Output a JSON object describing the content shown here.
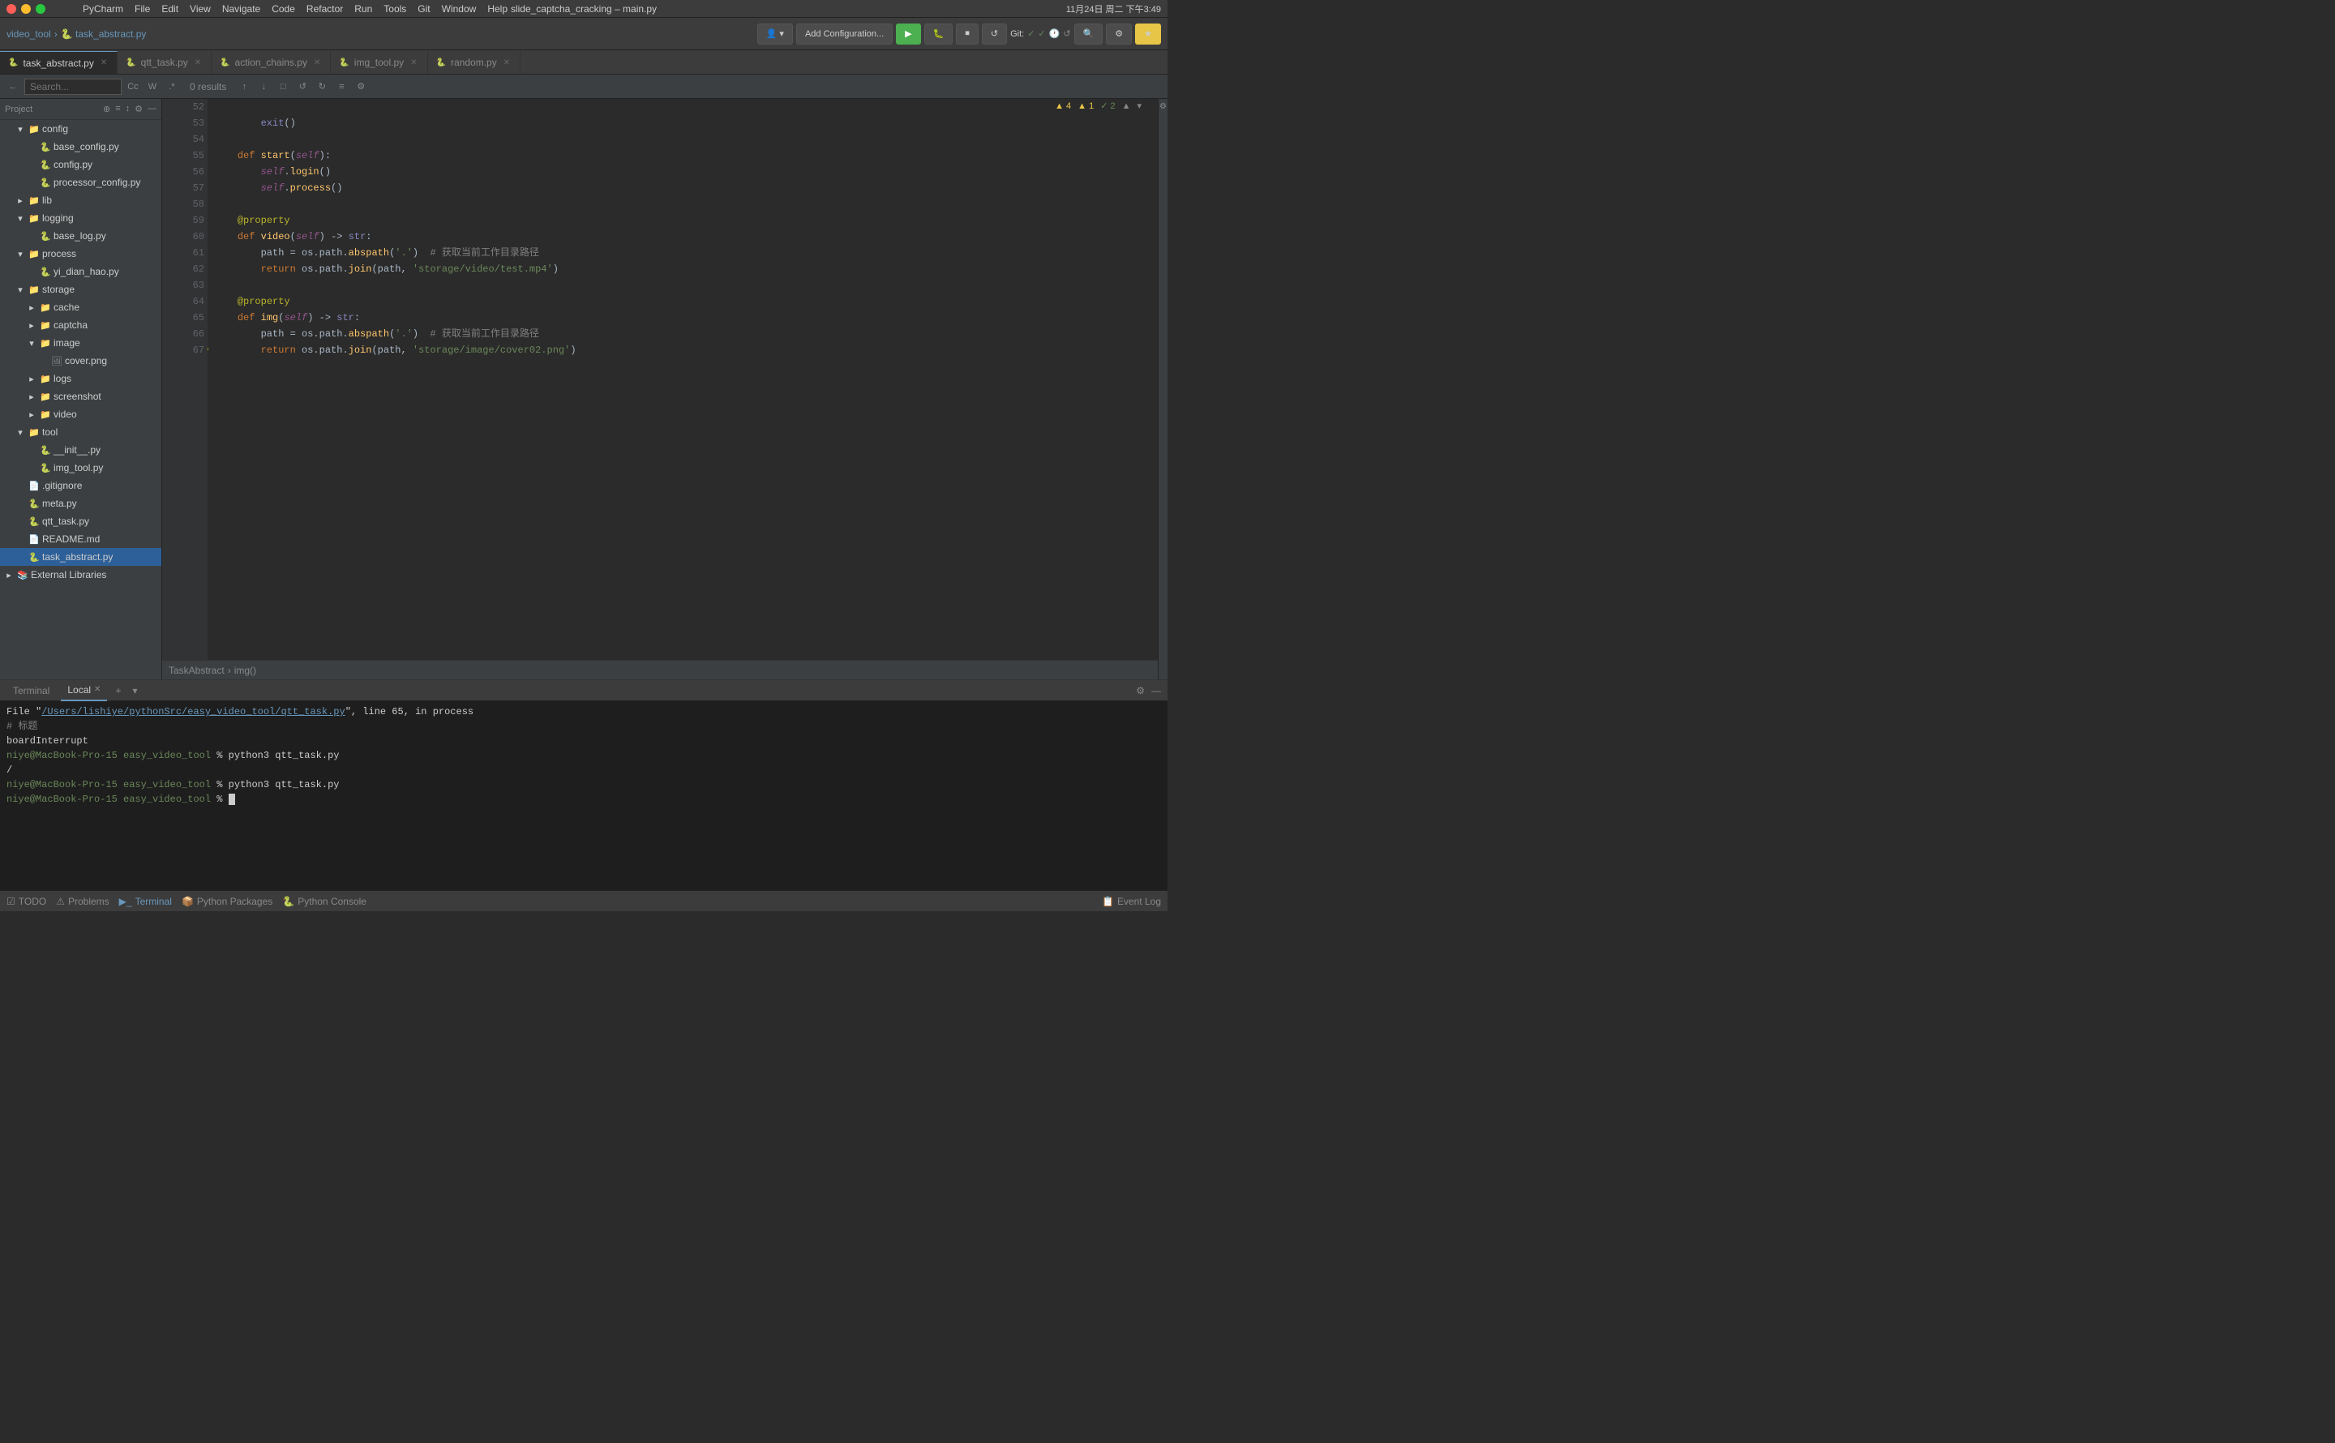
{
  "titlebar": {
    "title": "slide_captcha_cracking – main.py",
    "menus": [
      "PyCharm",
      "File",
      "Edit",
      "View",
      "Navigate",
      "Code",
      "Refactor",
      "Run",
      "Tools",
      "Git",
      "Window",
      "Help"
    ],
    "time": "11月24日 周二 下午3:49"
  },
  "ide_toolbar": {
    "breadcrumb_root": "video_tool",
    "breadcrumb_file": "task_abstract.py",
    "config_btn": "Add Configuration...",
    "git_label": "Git:"
  },
  "tabs": [
    {
      "label": "task_abstract.py",
      "icon": "🐍",
      "active": true
    },
    {
      "label": "qtt_task.py",
      "icon": "🐍",
      "active": false
    },
    {
      "label": "action_chains.py",
      "icon": "🐍",
      "active": false
    },
    {
      "label": "img_tool.py",
      "icon": "🐍",
      "active": false
    },
    {
      "label": "random.py",
      "icon": "🐍",
      "active": false
    }
  ],
  "search_bar": {
    "placeholder": "Search...",
    "results": "0 results"
  },
  "sidebar": {
    "header": "Project",
    "items": [
      {
        "label": "config",
        "type": "folder",
        "indent": 1,
        "expanded": true
      },
      {
        "label": "base_config.py",
        "type": "py",
        "indent": 2
      },
      {
        "label": "config.py",
        "type": "py",
        "indent": 2
      },
      {
        "label": "processor_config.py",
        "type": "py",
        "indent": 2
      },
      {
        "label": "lib",
        "type": "folder",
        "indent": 1
      },
      {
        "label": "logging",
        "type": "folder",
        "indent": 1,
        "expanded": true
      },
      {
        "label": "base_log.py",
        "type": "py",
        "indent": 2
      },
      {
        "label": "process",
        "type": "folder",
        "indent": 1,
        "expanded": true
      },
      {
        "label": "yi_dian_hao.py",
        "type": "py",
        "indent": 2
      },
      {
        "label": "storage",
        "type": "folder",
        "indent": 1,
        "expanded": true
      },
      {
        "label": "cache",
        "type": "folder",
        "indent": 2
      },
      {
        "label": "captcha",
        "type": "folder",
        "indent": 2
      },
      {
        "label": "image",
        "type": "folder",
        "indent": 2,
        "expanded": true
      },
      {
        "label": "cover.png",
        "type": "img",
        "indent": 3
      },
      {
        "label": "logs",
        "type": "folder",
        "indent": 2
      },
      {
        "label": "screenshot",
        "type": "folder",
        "indent": 2
      },
      {
        "label": "video",
        "type": "folder",
        "indent": 2
      },
      {
        "label": "tool",
        "type": "folder",
        "indent": 1,
        "expanded": true
      },
      {
        "label": "__init__.py",
        "type": "py",
        "indent": 2
      },
      {
        "label": "img_tool.py",
        "type": "py",
        "indent": 2
      },
      {
        "label": ".gitignore",
        "type": "other",
        "indent": 1
      },
      {
        "label": "meta.py",
        "type": "py",
        "indent": 1
      },
      {
        "label": "qtt_task.py",
        "type": "py",
        "indent": 1
      },
      {
        "label": "README.md",
        "type": "other",
        "indent": 1
      },
      {
        "label": "task_abstract.py",
        "type": "py",
        "indent": 1
      },
      {
        "label": "External Libraries",
        "type": "folder",
        "indent": 0
      }
    ]
  },
  "code": {
    "lines": [
      {
        "num": 52,
        "content": "        exit()"
      },
      {
        "num": 53,
        "content": ""
      },
      {
        "num": 54,
        "content": "    def start(self):"
      },
      {
        "num": 55,
        "content": "        self.login()"
      },
      {
        "num": 56,
        "content": "        self.process()"
      },
      {
        "num": 57,
        "content": ""
      },
      {
        "num": 58,
        "content": "    @property"
      },
      {
        "num": 59,
        "content": "    def video(self) -> str:"
      },
      {
        "num": 60,
        "content": "        path = os.path.abspath('.')  # 获取当前工作目录路径"
      },
      {
        "num": 61,
        "content": "        return os.path.join(path, 'storage/video/test.mp4')"
      },
      {
        "num": 62,
        "content": ""
      },
      {
        "num": 63,
        "content": "    @property"
      },
      {
        "num": 64,
        "content": "    def img(self) -> str:"
      },
      {
        "num": 65,
        "content": "        path = os.path.abspath('.')  # 获取当前工作目录路径"
      },
      {
        "num": 66,
        "content": "        return os.path.join(path, 'storage/image/cover02.png')"
      },
      {
        "num": 67,
        "content": ""
      }
    ],
    "breadcrumb": "TaskAbstract  >  img()",
    "warnings": "▲ 4  ▲ 1  ✓ 2"
  },
  "terminal": {
    "tabs": [
      "Terminal",
      "Local",
      "Python Packages",
      "Python Console"
    ],
    "active_tab": "Local",
    "lines": [
      {
        "text": "File \"/Users/lishiye/pythonSrc/easy_video_tool/qtt_task.py\", line 65, in process",
        "type": "link"
      },
      {
        "text": "# 标题",
        "type": "comment"
      },
      {
        "text": "boardInterrupt",
        "type": "normal"
      },
      {
        "text": "",
        "type": "normal"
      },
      {
        "text": "niye@MacBook-Pro-15 easy_video_tool % python3 qtt_task.py",
        "type": "prompt"
      },
      {
        "text": "/",
        "type": "normal"
      },
      {
        "text": "niye@MacBook-Pro-15 easy_video_tool % python3 qtt_task.py",
        "type": "prompt"
      },
      {
        "text": "",
        "type": "normal"
      },
      {
        "text": "niye@MacBook-Pro-15 easy_video_tool % ",
        "type": "prompt_active"
      }
    ]
  },
  "status_bar": {
    "items": [
      "TODO",
      "Problems",
      "Terminal",
      "Python Packages",
      "Python Console",
      "Event Log"
    ]
  }
}
